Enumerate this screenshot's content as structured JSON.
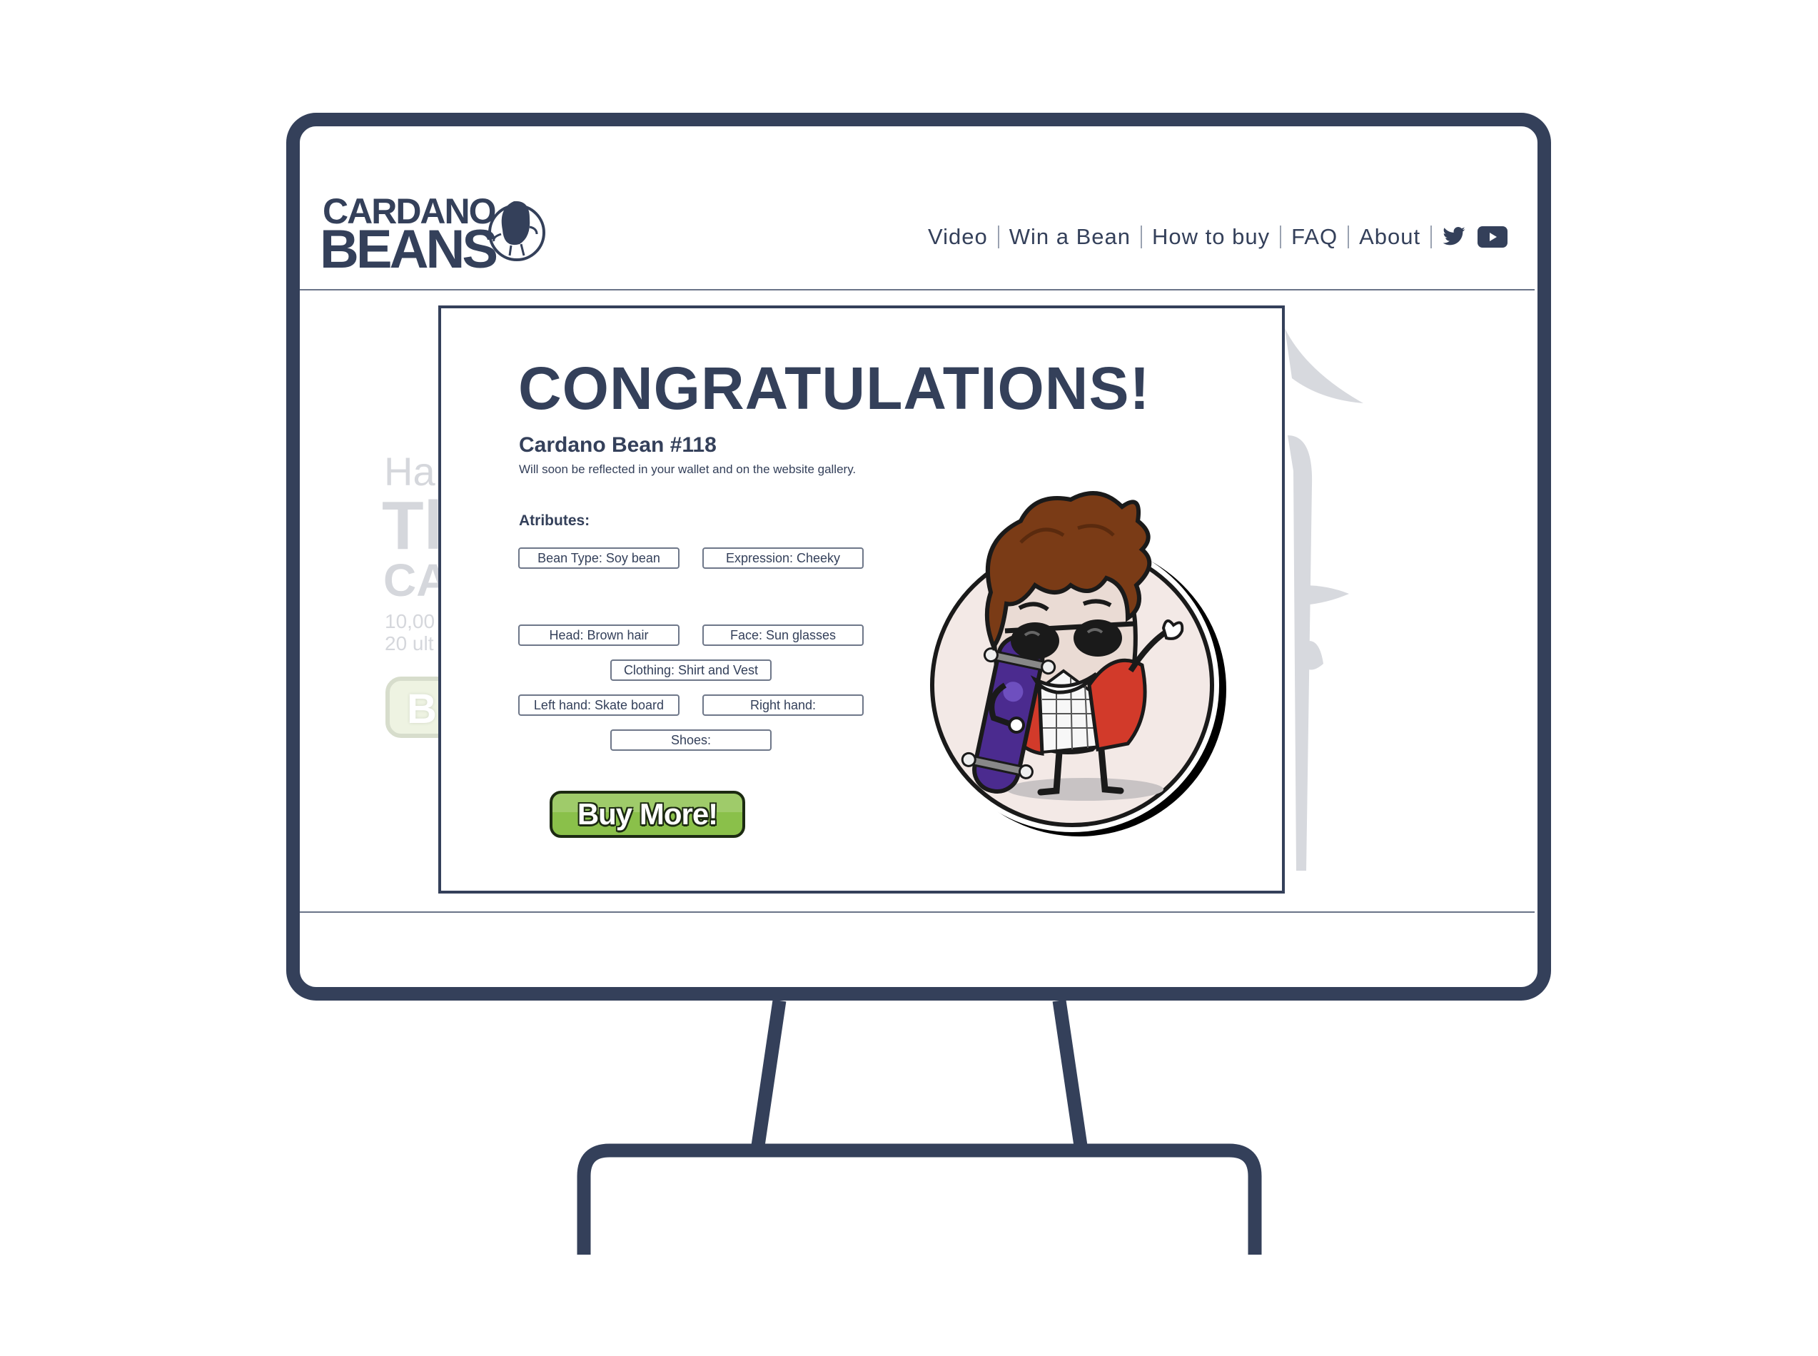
{
  "header": {
    "logo": {
      "line1": "CARDANO",
      "line2": "BEANS"
    },
    "nav": [
      {
        "label": "Video"
      },
      {
        "label": "Win a Bean"
      },
      {
        "label": "How to buy"
      },
      {
        "label": "FAQ"
      },
      {
        "label": "About"
      }
    ],
    "social_icons": [
      "twitter-icon",
      "youtube-icon"
    ]
  },
  "background_page": {
    "small_text": "Ha",
    "big_text_1": "Tl",
    "big_text_2": "CA",
    "line_1": "10,00",
    "line_2": "20 ult",
    "button_letter": "B"
  },
  "modal": {
    "title": "CONGRATULATIONS!",
    "bean_name": "Cardano Bean #118",
    "subtitle": "Will soon be reflected in your wallet and on the website gallery.",
    "attributes_heading": "Atributes:",
    "attributes": {
      "bean_type": "Bean Type: Soy bean",
      "expression": "Expression: Cheeky",
      "head": "Head: Brown hair",
      "face": "Face: Sun glasses",
      "clothing": "Clothing: Shirt and Vest",
      "left_hand": "Left hand: Skate board",
      "right_hand": "Right hand:",
      "shoes": "Shoes:"
    },
    "buy_button": "Buy More!"
  },
  "colors": {
    "frame": "#34405a",
    "button_green": "#8ac04a",
    "faded_text": "#d5d7dc"
  }
}
